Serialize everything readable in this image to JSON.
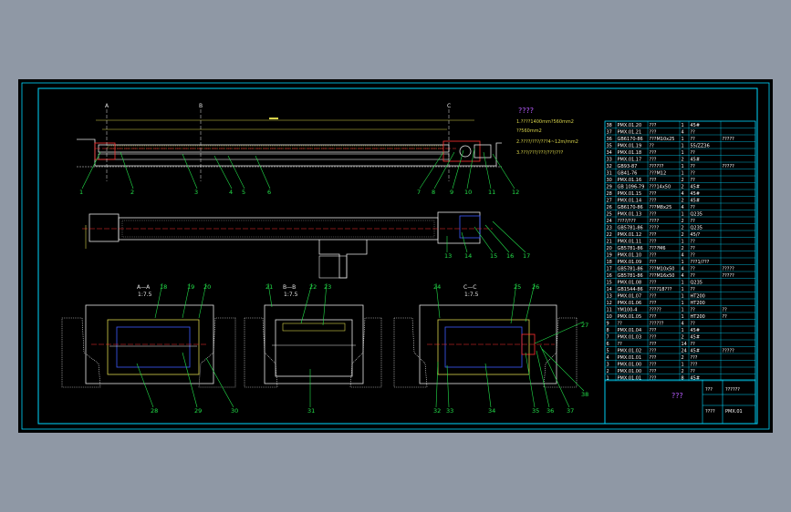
{
  "notes": {
    "heading": "????",
    "lines": [
      "1.????1400mm?560mm2",
      "  ??560mm2",
      "2.????/???/???4~12m/mm2",
      "3.???/???/???/???/???"
    ]
  },
  "section_labels": {
    "a": "A—A",
    "a_scale": "1:7.5",
    "b": "B—B",
    "b_scale": "1:7.5",
    "c": "C—C",
    "c_scale": "1:7.5"
  },
  "cut_marks": {
    "a": "A",
    "b": "B",
    "c": "C"
  },
  "balloons_top": [
    "1",
    "2",
    "3",
    "4",
    "5",
    "6",
    "7",
    "8",
    "9",
    "10",
    "11",
    "12"
  ],
  "balloons_plan": [
    "13",
    "14",
    "15",
    "16",
    "17"
  ],
  "balloons_sections": [
    "18",
    "19",
    "20",
    "21",
    "22",
    "23",
    "24",
    "25",
    "26",
    "27",
    "28",
    "29",
    "30",
    "31",
    "32",
    "33",
    "34",
    "35",
    "36",
    "37",
    "38"
  ],
  "bom_rows": [
    [
      "38",
      "PMX.01.20",
      "???",
      "1",
      "45#",
      ""
    ],
    [
      "37",
      "PMX.01.21",
      "???",
      "4",
      "??",
      ""
    ],
    [
      "36",
      "GB6170-86",
      "???M10x25",
      "1",
      "??",
      "?????"
    ],
    [
      "35",
      "PMX.01.19",
      "??",
      "1",
      "55/ZZ36",
      ""
    ],
    [
      "34",
      "PMX.01.18",
      "???",
      "1",
      "??",
      ""
    ],
    [
      "33",
      "PMX.01.17",
      "???",
      "2",
      "45#",
      ""
    ],
    [
      "32",
      "GB93-87",
      "??????",
      "1",
      "??",
      "?????"
    ],
    [
      "31",
      "GB41-76",
      "???M12",
      "1",
      "??",
      ""
    ],
    [
      "30",
      "PMX.01.16",
      "???",
      "2",
      "??",
      ""
    ],
    [
      "29",
      "GB 1096-79",
      "???14x50",
      "2",
      "45#",
      ""
    ],
    [
      "28",
      "PMX.01.15",
      "???",
      "4",
      "45#",
      ""
    ],
    [
      "27",
      "PMX.01.14",
      "???",
      "2",
      "45#",
      ""
    ],
    [
      "26",
      "GB6170-86",
      "???M8x25",
      "4",
      "??",
      ""
    ],
    [
      "25",
      "PMX.01.13",
      "???",
      "1",
      "Q235",
      ""
    ],
    [
      "24",
      "????/???",
      "????",
      "2",
      "??",
      ""
    ],
    [
      "23",
      "GB5781-86",
      "????",
      "2",
      "Q235",
      ""
    ],
    [
      "22",
      "PMX.01.12",
      "???",
      "2",
      "45/?",
      ""
    ],
    [
      "21",
      "PMX.01.11",
      "???",
      "1",
      "??",
      ""
    ],
    [
      "20",
      "GB5781-86",
      "????M6",
      "2",
      "??",
      ""
    ],
    [
      "19",
      "PMX.01.10",
      "???",
      "4",
      "??",
      ""
    ],
    [
      "18",
      "PMX.01.09",
      "???",
      "1",
      "???1/???",
      ""
    ],
    [
      "17",
      "GB5781-86",
      "???M10x50",
      "4",
      "??",
      "?????"
    ],
    [
      "16",
      "GB5781-86",
      "???M16x50",
      "4",
      "??",
      "?????"
    ],
    [
      "15",
      "PMX.01.08",
      "???",
      "1",
      "Q235",
      ""
    ],
    [
      "14",
      "GB1544-86",
      "????18???",
      "1",
      "??",
      ""
    ],
    [
      "13",
      "PMX.01.07",
      "???",
      "1",
      "HT200",
      ""
    ],
    [
      "12",
      "PMX.01.06",
      "???",
      "1",
      "HT200",
      ""
    ],
    [
      "11",
      "YM100-4",
      "?????",
      "1",
      "??",
      "??"
    ],
    [
      "10",
      "PMX.01.05",
      "???",
      "1",
      "HT200",
      "??"
    ],
    [
      "9",
      "??",
      "??????",
      "4",
      "??",
      ""
    ],
    [
      "8",
      "PMX.01.04",
      "???",
      "1",
      "45#",
      ""
    ],
    [
      "7",
      "PMX.01.03",
      "???",
      "2",
      "45#",
      ""
    ],
    [
      "6",
      "??",
      "???",
      "14",
      "??",
      ""
    ],
    [
      "5",
      "PMX.01.02",
      "???",
      "24",
      "45#",
      "?????"
    ],
    [
      "4",
      "PMX.01.01",
      "???",
      "2",
      "???",
      ""
    ],
    [
      "3",
      "PMX.01.00",
      "???",
      "1",
      "???",
      ""
    ],
    [
      "2",
      "PMX.01.00",
      "???",
      "2",
      "??",
      ""
    ],
    [
      "1",
      "PMX.01.01",
      "???",
      "8",
      "45#",
      ""
    ]
  ],
  "title_block": {
    "name": "???",
    "scale_label": "???",
    "scale_value": "??????",
    "drawing_label": "????",
    "drawing_no": "PMX.01"
  },
  "colors": {
    "background": "#8f98a5",
    "sheet": "#000000",
    "border": "#00d8ff",
    "outline": "#e6e6e6",
    "leader": "#23e04a",
    "hidden": "#3b5bff",
    "center": "#ff3030",
    "dim": "#d8d34a",
    "title": "#b85cff"
  }
}
